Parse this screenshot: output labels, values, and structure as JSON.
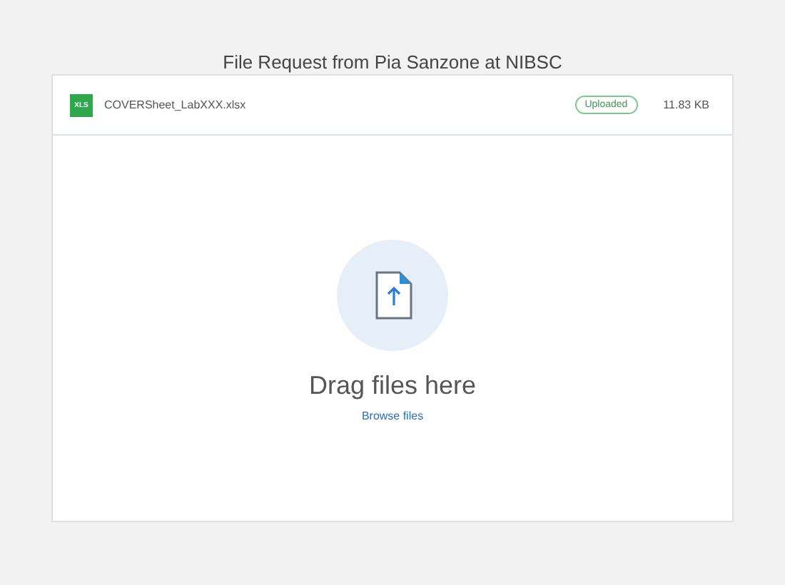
{
  "title": "File Request from Pia Sanzone at NIBSC",
  "files": [
    {
      "badge": "XLS",
      "name": "COVERSheet_LabXXX.xlsx",
      "status": "Uploaded",
      "size": "11.83 KB"
    }
  ],
  "dropzone": {
    "prompt": "Drag files here",
    "link": "Browse files"
  }
}
